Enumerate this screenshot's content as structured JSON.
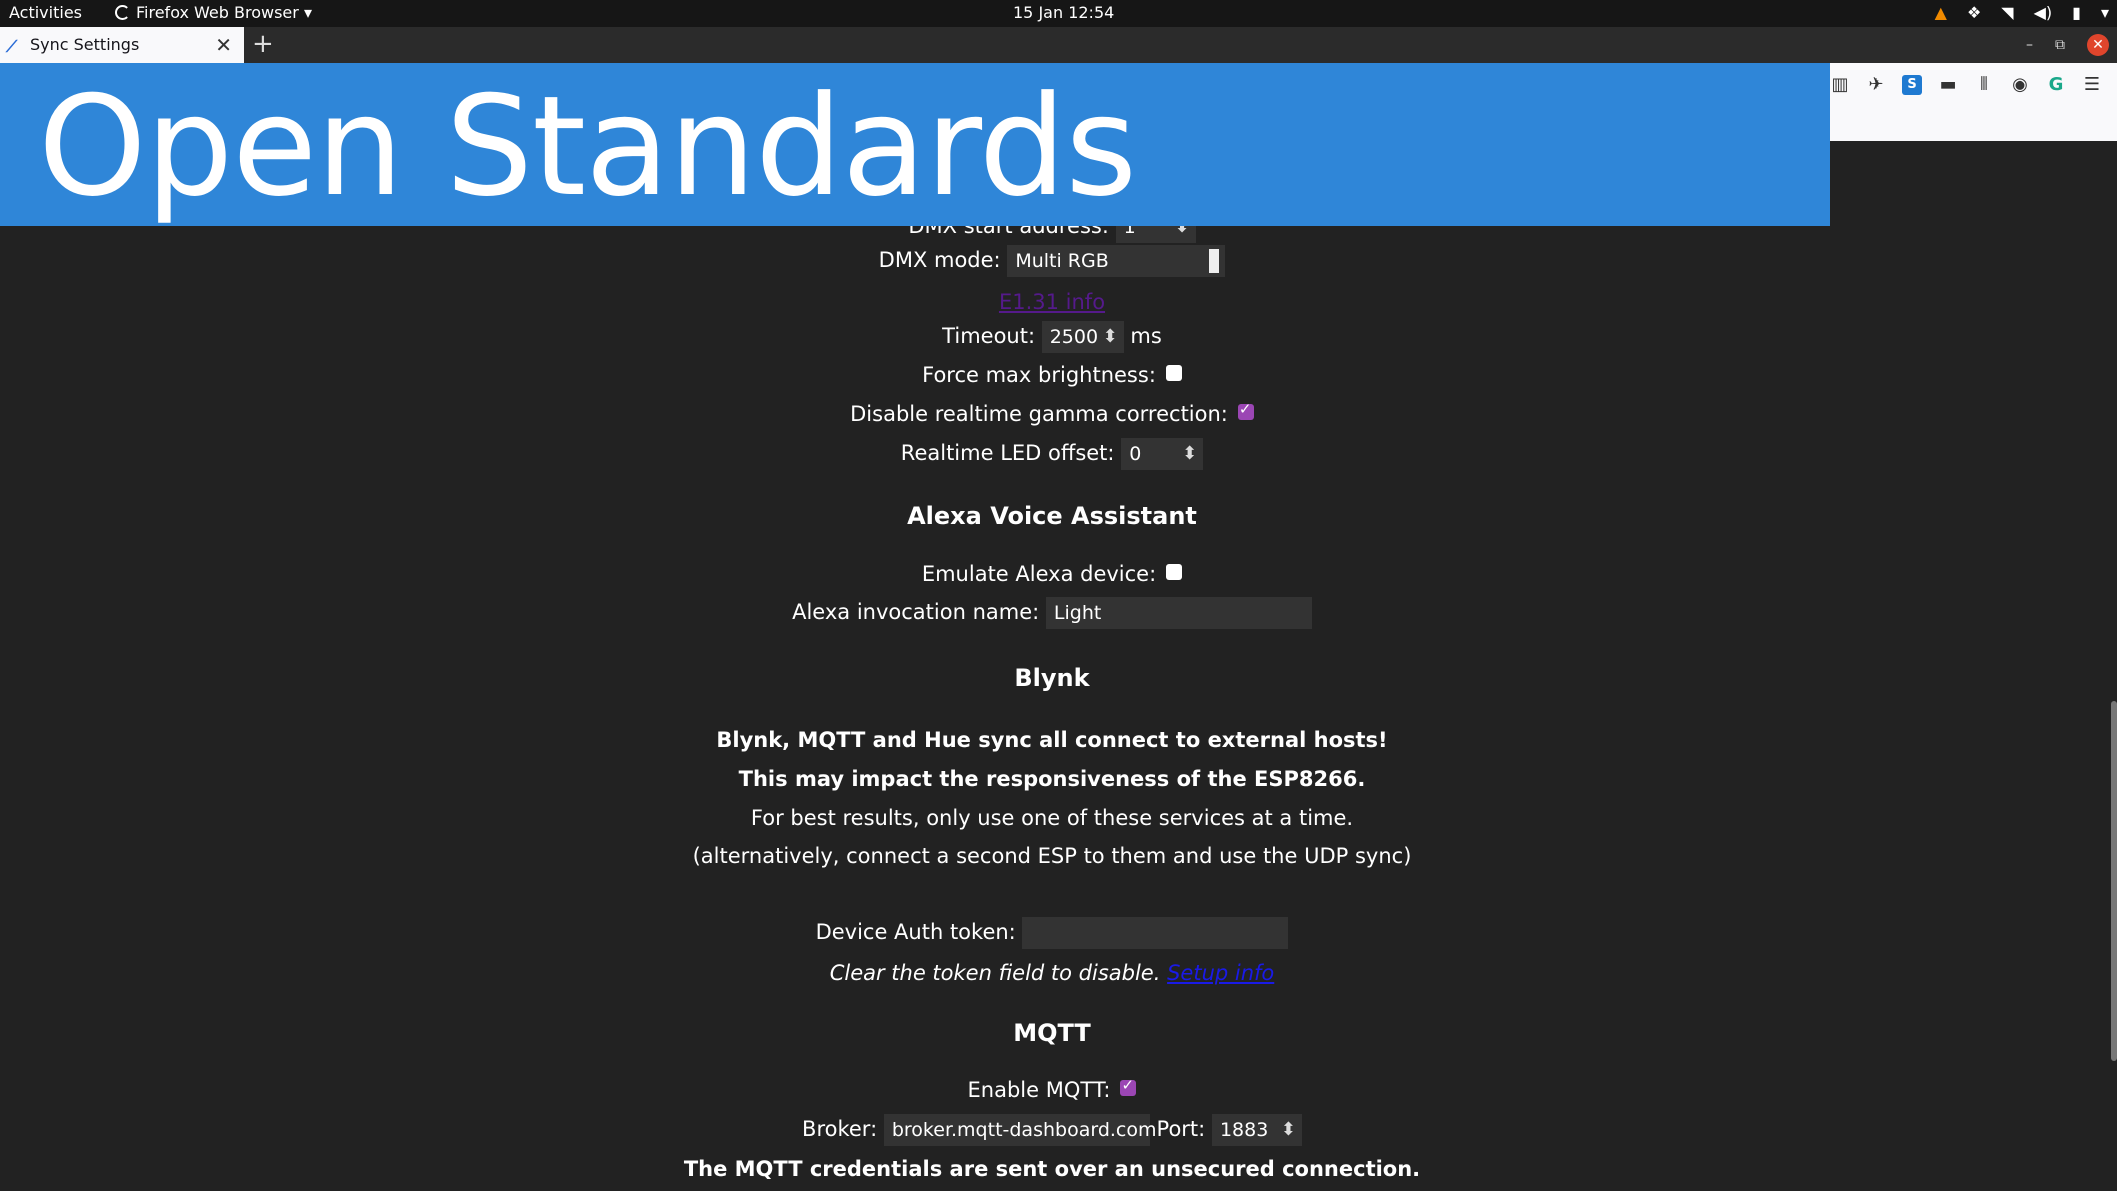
{
  "system_bar": {
    "activities": "Activities",
    "app_menu": "Firefox Web Browser",
    "clock": "15 Jan  12:54",
    "tray_icons": [
      "vlc-icon",
      "dropbox-icon",
      "wifi-icon",
      "volume-icon",
      "battery-icon",
      "system-menu-chevron-icon"
    ]
  },
  "browser": {
    "tab_title": "Sync Settings",
    "tab_close": "✕",
    "new_tab": "+",
    "toolbar_icons": [
      "sidebar-icon",
      "extension-icon",
      "skype-icon",
      "screen-icon",
      "library-icon",
      "account-icon",
      "grammarly-icon",
      "menu-icon"
    ]
  },
  "banner": {
    "title": "Open Standards"
  },
  "page": {
    "dmx_start_label": "DMX start address:",
    "dmx_start_value": "1",
    "dmx_mode_label": "DMX mode:",
    "dmx_mode_value": "Multi RGB",
    "e131_link": "E1.31 info",
    "timeout_label": "Timeout:",
    "timeout_value": "2500",
    "timeout_unit": "ms",
    "force_max_label": "Force max brightness:",
    "force_max_checked": false,
    "gamma_label": "Disable realtime gamma correction:",
    "gamma_checked": true,
    "led_offset_label": "Realtime LED offset:",
    "led_offset_value": "0",
    "alexa_heading": "Alexa Voice Assistant",
    "emulate_alexa_label": "Emulate Alexa device:",
    "emulate_alexa_checked": false,
    "alexa_name_label": "Alexa invocation name:",
    "alexa_name_value": "Light",
    "blynk_heading": "Blynk",
    "warning_line1": "Blynk, MQTT and Hue sync all connect to external hosts!",
    "warning_line2": "This may impact the responsiveness of the ESP8266.",
    "note_line1": "For best results, only use one of these services at a time.",
    "note_line2": "(alternatively, connect a second ESP to them and use the UDP sync)",
    "auth_label": "Device Auth token:",
    "auth_value": "",
    "clear_token_text": "Clear the token field to disable.",
    "setup_info_link": "Setup info",
    "mqtt_heading": "MQTT",
    "enable_mqtt_label": "Enable MQTT:",
    "enable_mqtt_checked": true,
    "broker_label": "Broker:",
    "broker_value": "broker.mqtt-dashboard.com",
    "port_label": "Port:",
    "port_value": "1883",
    "mqtt_warning": "The MQTT credentials are sent over an unsecured connection."
  },
  "colors": {
    "page_bg": "#222222",
    "banner_bg": "#2f86d8",
    "checkbox_checked": "#9b46b4",
    "visited_link": "#551a8b",
    "link": "#1a1ae6"
  }
}
